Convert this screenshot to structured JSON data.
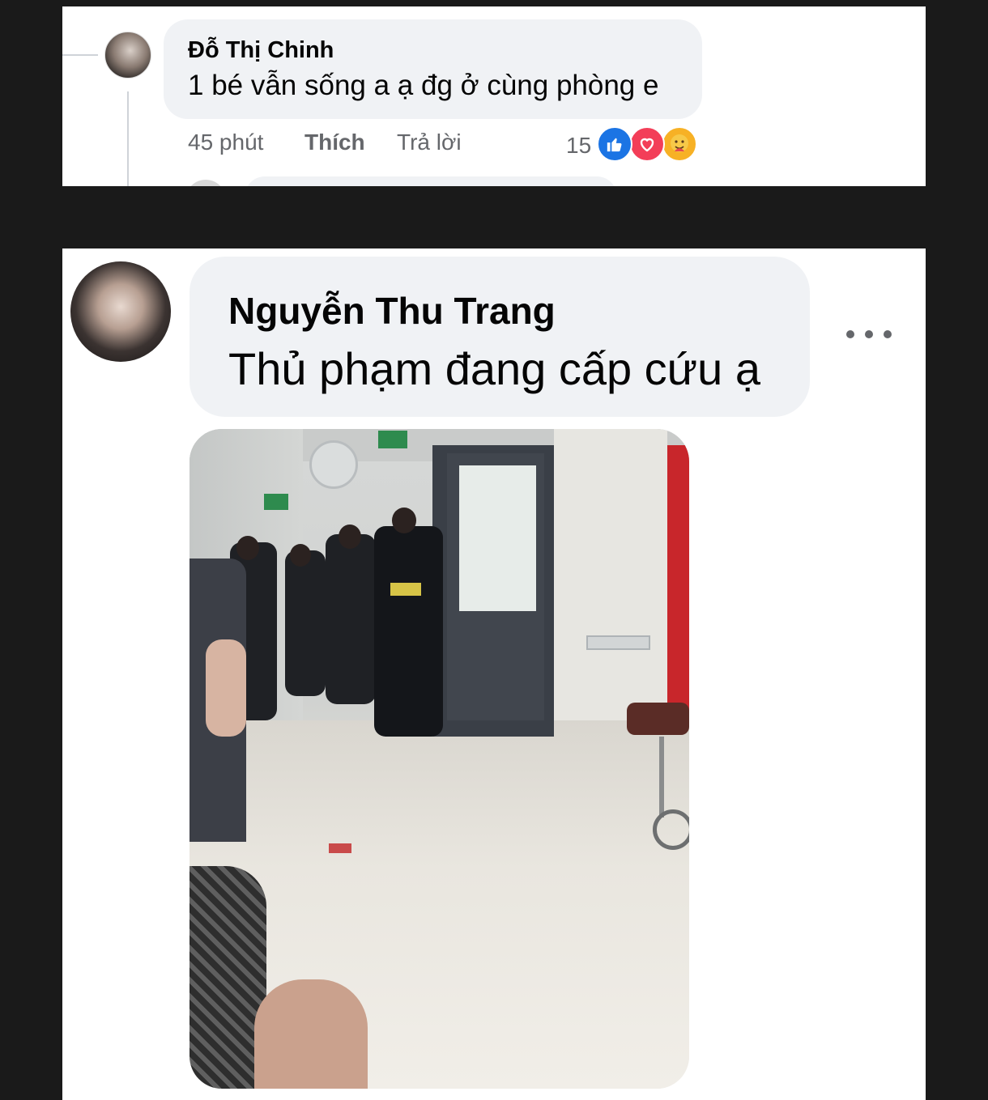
{
  "comment_top": {
    "author": "Đỗ Thị Chinh",
    "text": "1 bé vẫn sống a ạ đg ở cùng phòng e",
    "time": "45 phút",
    "like_label": "Thích",
    "reply_label": "Trả lời",
    "reaction_count": "15",
    "reactions": [
      "like-icon",
      "love-icon",
      "care-icon"
    ],
    "colors": {
      "like": "#1b74e4",
      "love": "#f33e58",
      "care": "#f7b125"
    }
  },
  "comment_main": {
    "author": "Nguyễn Thu Trang",
    "text": "Thủ phạm đang cấp cứu ạ",
    "more_icon": "more-options-icon",
    "attachment": "hospital-corridor-photo"
  },
  "theme": {
    "background": "#1a1a1a",
    "card": "#ffffff",
    "bubble": "#f0f2f5",
    "text_primary": "#050505",
    "text_secondary": "#65676b"
  }
}
